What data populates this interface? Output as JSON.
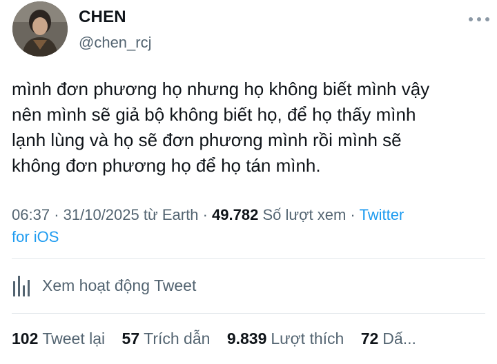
{
  "author": {
    "name": "CHEN",
    "handle": "@chen_rcj"
  },
  "tweet": {
    "lines": [
      "mình đơn phương họ nhưng họ không biết mình vậy",
      "nên mình sẽ giả bộ không biết họ, để họ thấy mình",
      "lạnh lùng và họ sẽ đơn phương mình rồi mình sẽ",
      "không đơn phương họ để họ tán mình."
    ]
  },
  "meta": {
    "time": "06:37",
    "date": "31/10/2025",
    "source_prefix": "từ",
    "location": "Earth",
    "views_count": "49.782",
    "views_label": "Số lượt xem",
    "client_part1": "Twitter",
    "client_part2": "for iOS",
    "separator": "·"
  },
  "activity": {
    "label": "Xem hoạt động Tweet",
    "icon": "bar-chart-icon"
  },
  "stats": [
    {
      "count": "102",
      "label": "Tweet lại"
    },
    {
      "count": "57",
      "label": "Trích dẫn"
    },
    {
      "count": "9.839",
      "label": "Lượt thích"
    },
    {
      "count": "72",
      "label": "Dấ..."
    }
  ],
  "icons": {
    "more": "more-horizontal-icon"
  },
  "colors": {
    "text_primary": "#0f1419",
    "text_secondary": "#536471",
    "link": "#1d9bf0",
    "divider": "#e1e6ea"
  }
}
